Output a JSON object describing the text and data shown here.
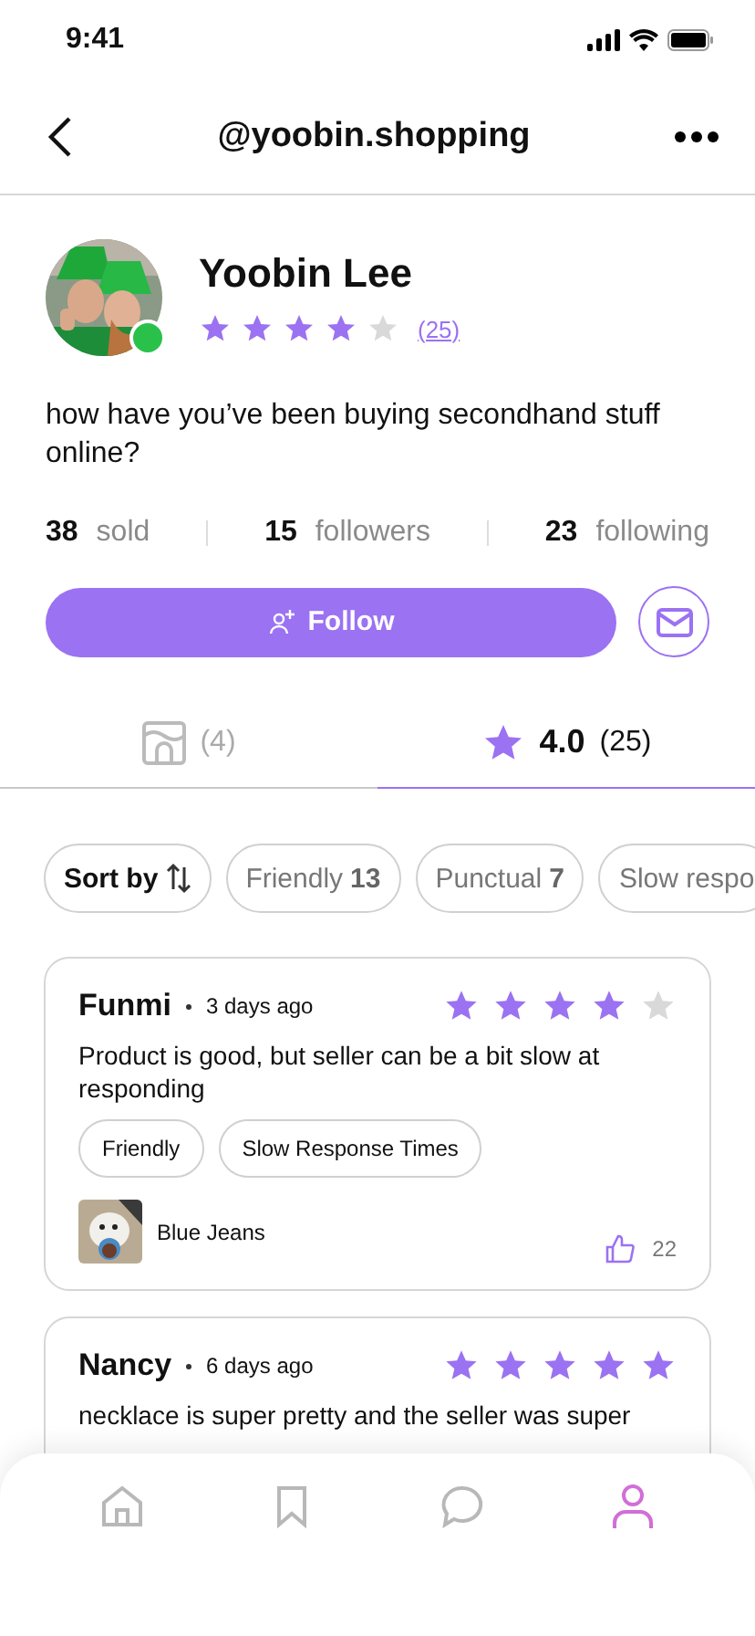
{
  "status_bar": {
    "time": "9:41"
  },
  "header": {
    "title": "@yoobin.shopping"
  },
  "profile": {
    "name": "Yoobin Lee",
    "online": true,
    "stars": 4,
    "review_count": "(25)",
    "bio": "how have you’ve been buying secondhand stuff online?",
    "stats": [
      {
        "value": "38",
        "label": "sold"
      },
      {
        "value": "15",
        "label": "followers"
      },
      {
        "value": "23",
        "label": "following"
      }
    ],
    "follow_button": "Follow"
  },
  "tabs": [
    {
      "kind": "listings",
      "label": "(4)",
      "selected": false
    },
    {
      "kind": "rating",
      "value": "4.0",
      "label": "(25)",
      "selected": true
    }
  ],
  "chips": [
    {
      "kind": "sort",
      "label": "Sort by"
    },
    {
      "kind": "filter",
      "label": "Friendly",
      "count": "13"
    },
    {
      "kind": "filter",
      "label": "Punctual",
      "count": "7"
    },
    {
      "kind": "filter",
      "label": "Slow respo"
    }
  ],
  "reviews": [
    {
      "name": "Funmi",
      "time": "3 days ago",
      "stars": 4,
      "text": "Product is good, but seller can be a bit slow at responding",
      "tags": [
        "Friendly",
        "Slow Response Times"
      ],
      "product": "Blue Jeans",
      "likes": "22"
    },
    {
      "name": "Nancy",
      "time": "6 days ago",
      "stars": 5,
      "text": "necklace is super pretty and the seller was super"
    }
  ],
  "nav": [
    {
      "kind": "home",
      "selected": false
    },
    {
      "kind": "bookmark",
      "selected": false
    },
    {
      "kind": "chat",
      "selected": false
    },
    {
      "kind": "profile",
      "selected": true
    }
  ]
}
